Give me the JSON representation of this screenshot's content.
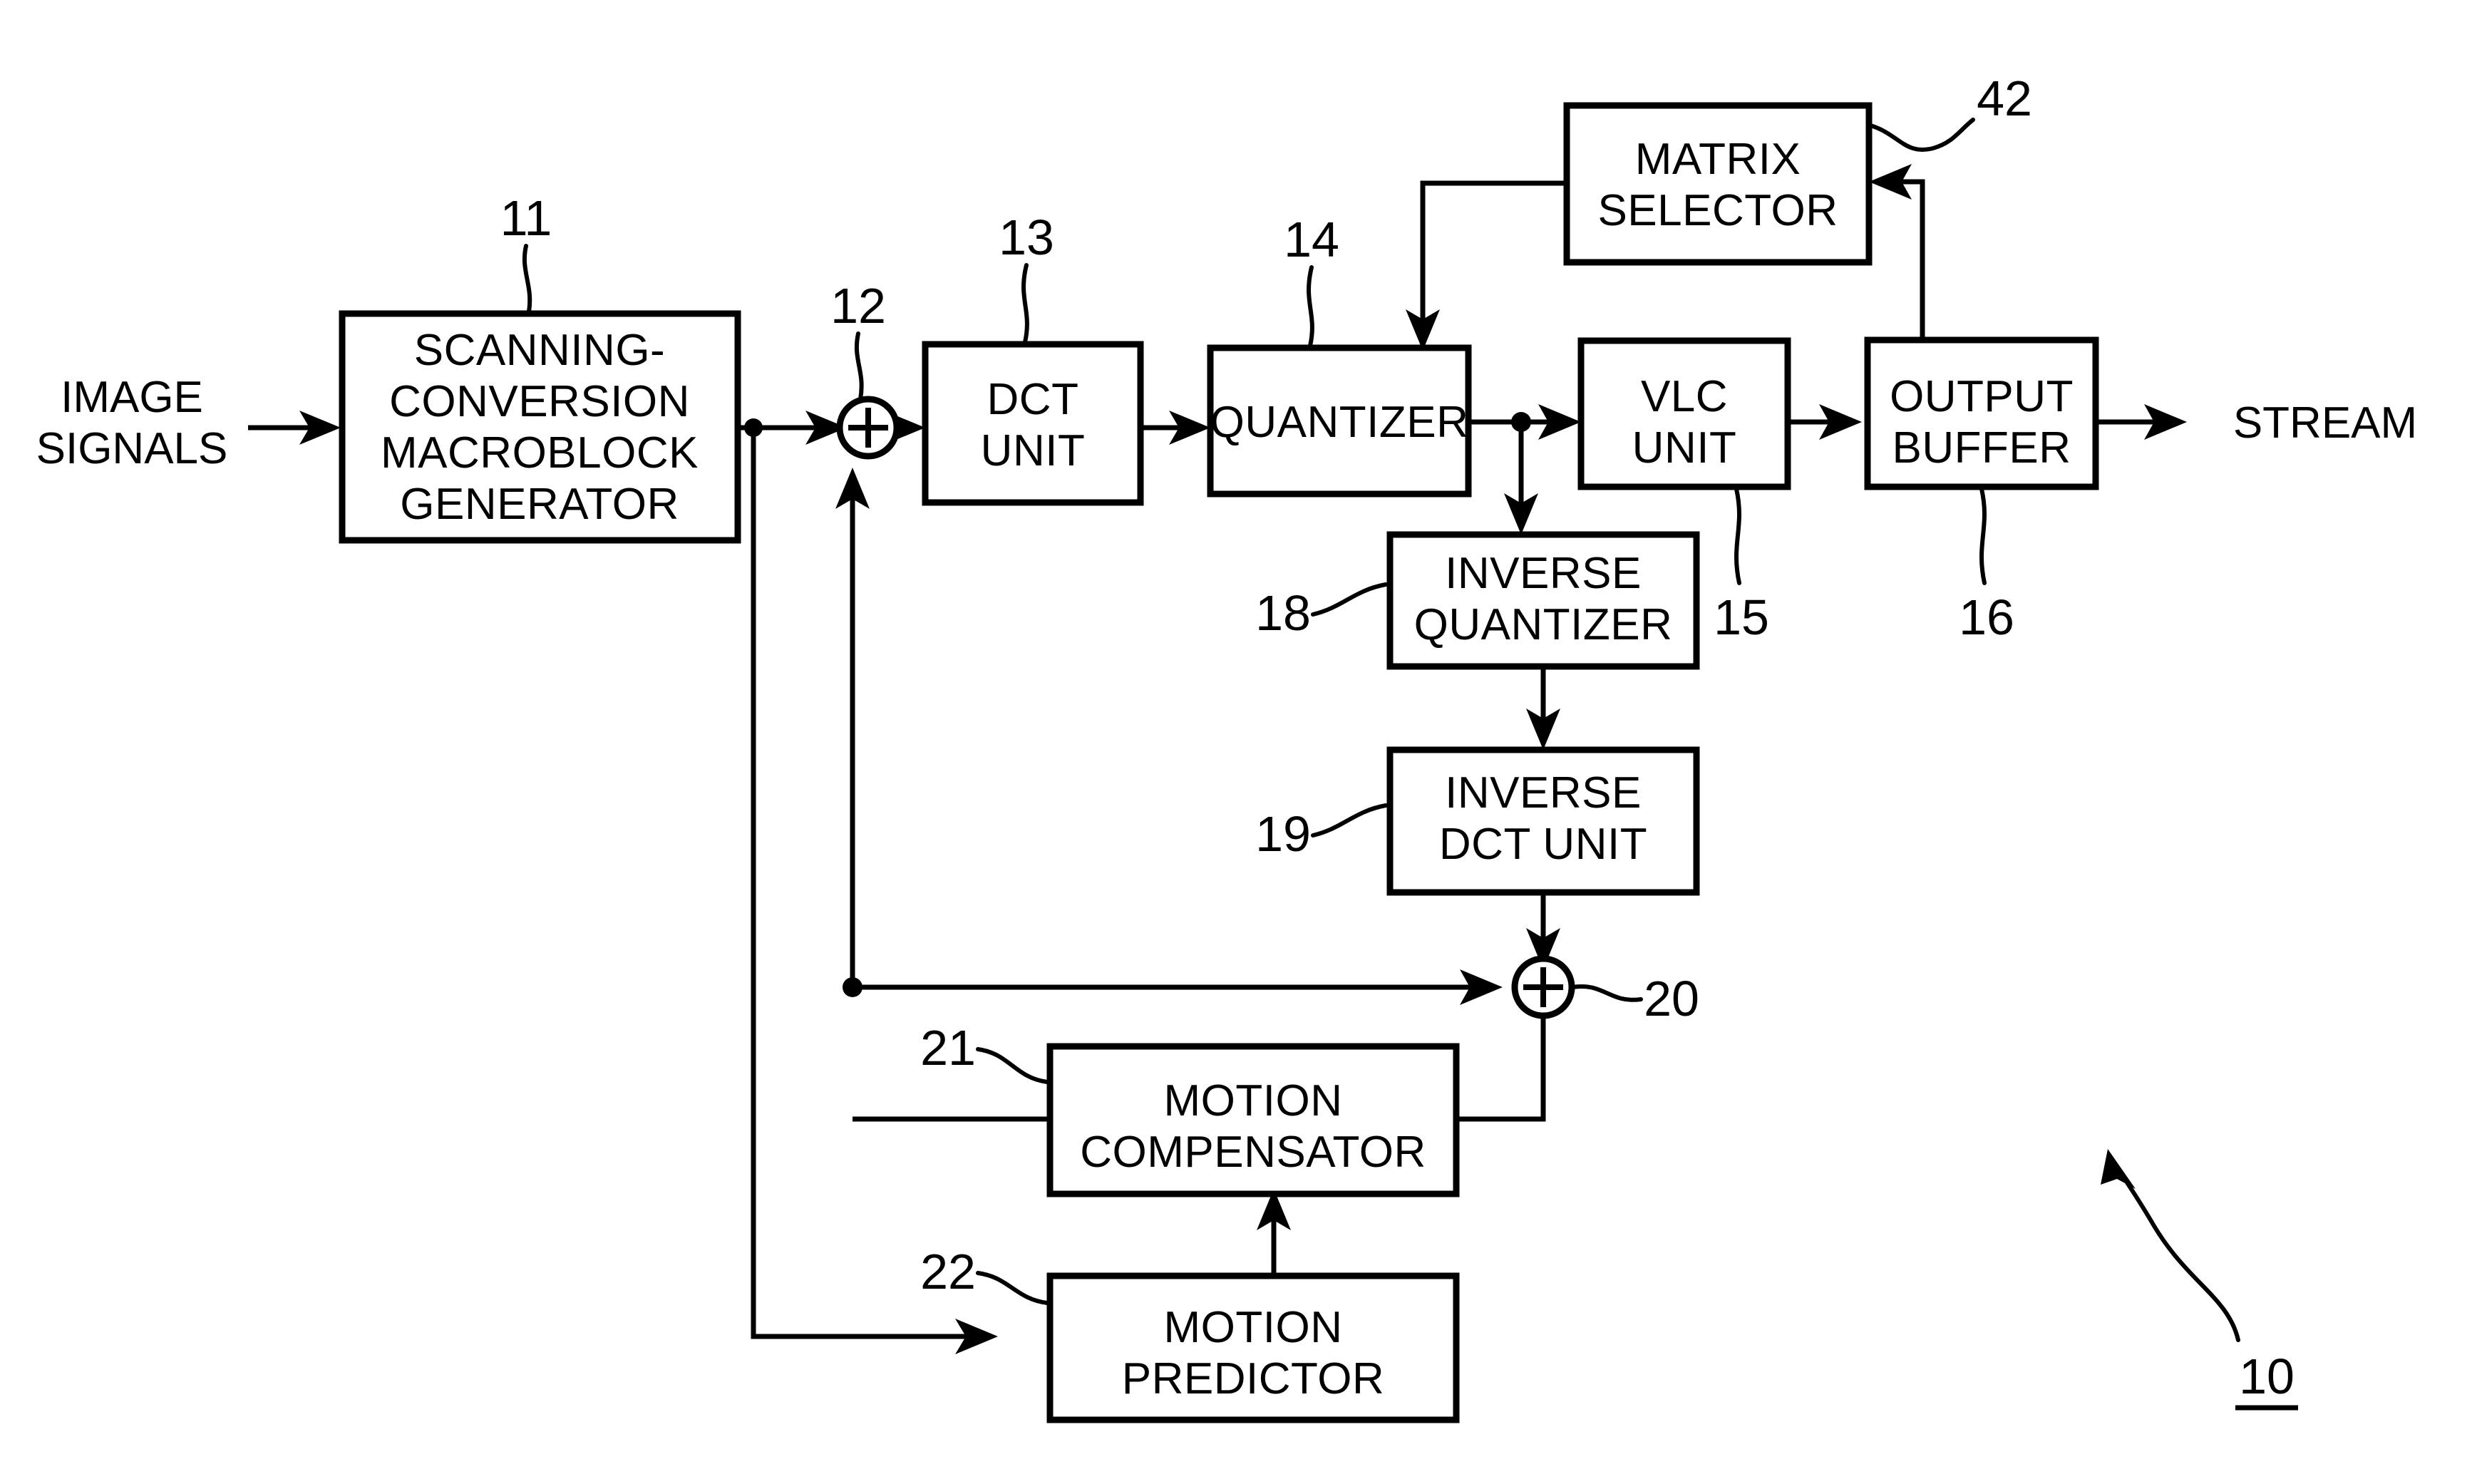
{
  "figure": {
    "kind": "patent-block-diagram",
    "overall_reference": "10",
    "background_color": "#ffffff",
    "line_color": "#000000"
  },
  "blocks": [
    {
      "id": "scanning",
      "ref": "11",
      "lines": [
        "SCANNING-",
        "CONVERSION",
        "MACROBLOCK",
        "GENERATOR"
      ]
    },
    {
      "id": "dct",
      "ref": "13",
      "lines": [
        "DCT",
        "UNIT"
      ]
    },
    {
      "id": "quantizer",
      "ref": "14",
      "lines": [
        "QUANTIZER"
      ]
    },
    {
      "id": "vlc",
      "ref": "15",
      "lines": [
        "VLC",
        "UNIT"
      ]
    },
    {
      "id": "outbuf",
      "ref": "16",
      "lines": [
        "OUTPUT",
        "BUFFER"
      ]
    },
    {
      "id": "matrix",
      "ref": "42",
      "lines": [
        "MATRIX",
        "SELECTOR"
      ]
    },
    {
      "id": "invquant",
      "ref": "18",
      "lines": [
        "INVERSE",
        "QUANTIZER"
      ]
    },
    {
      "id": "invdct",
      "ref": "19",
      "lines": [
        "INVERSE",
        "DCT  UNIT"
      ]
    },
    {
      "id": "motcomp",
      "ref": "21",
      "lines": [
        "MOTION",
        "COMPENSATOR"
      ]
    },
    {
      "id": "motpred",
      "ref": "22",
      "lines": [
        "MOTION",
        "PREDICTOR"
      ]
    }
  ],
  "adders": [
    {
      "id": "adder12",
      "ref": "12",
      "symbol": "+"
    },
    {
      "id": "adder20",
      "ref": "20",
      "symbol": "+"
    }
  ],
  "external_labels": {
    "input": {
      "lines": [
        "IMAGE",
        "SIGNALS"
      ]
    },
    "output": {
      "lines": [
        "STREAM"
      ]
    }
  },
  "reference_numerals": [
    "10",
    "11",
    "12",
    "13",
    "14",
    "15",
    "16",
    "18",
    "19",
    "20",
    "21",
    "22",
    "42"
  ]
}
